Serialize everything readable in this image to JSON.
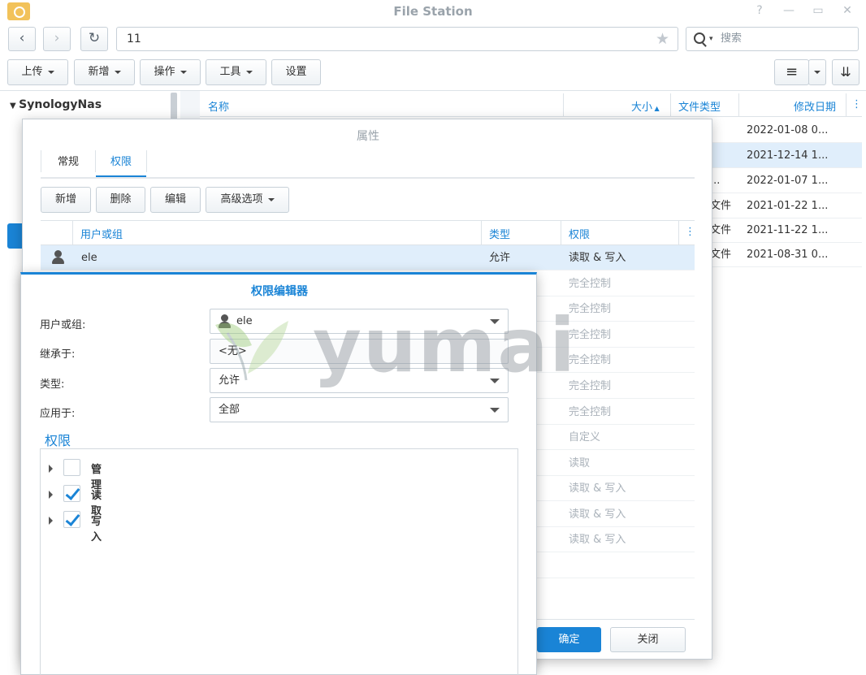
{
  "window": {
    "title": "File Station"
  },
  "nav": {
    "path": "11",
    "search_placeholder": "搜索"
  },
  "toolbar": {
    "upload": "上传",
    "new": "新增",
    "action": "操作",
    "tools": "工具",
    "settings": "设置"
  },
  "tree": {
    "root": "SynologyNas"
  },
  "file_list": {
    "columns": {
      "name": "名称",
      "size": "大小",
      "type": "文件类型",
      "modified": "修改日期"
    },
    "rows": [
      {
        "type": "",
        "modified": "2022-01-08 0..."
      },
      {
        "type": "",
        "modified": "2021-12-14 1...",
        "selected": true
      },
      {
        "type": "...",
        "modified": "2022-01-07 1..."
      },
      {
        "type": "文件",
        "modified": "2021-01-22 1..."
      },
      {
        "type": "文件",
        "modified": "2021-11-22 1..."
      },
      {
        "type": "文件",
        "modified": "2021-08-31 0..."
      }
    ]
  },
  "properties": {
    "title": "属性",
    "tabs": [
      "常规",
      "权限"
    ],
    "active_tab": "权限",
    "buttons": {
      "add": "新增",
      "delete": "删除",
      "edit": "编辑",
      "advanced": "高级选项"
    },
    "columns": {
      "user": "用户或组",
      "type": "类型",
      "perm": "权限"
    },
    "rows": [
      {
        "user": "ele",
        "type": "允许",
        "perm": "读取 & 写入",
        "selected": true
      },
      {
        "perm": "完全控制"
      },
      {
        "perm": "完全控制"
      },
      {
        "perm": "完全控制"
      },
      {
        "perm": "完全控制"
      },
      {
        "perm": "完全控制"
      },
      {
        "perm": "完全控制"
      },
      {
        "perm": "自定义"
      },
      {
        "perm": "读取"
      },
      {
        "perm": "读取 & 写入"
      },
      {
        "perm": "读取 & 写入"
      },
      {
        "perm": "读取 & 写入"
      }
    ],
    "ok": "确定",
    "close": "关闭"
  },
  "editor": {
    "title": "权限编辑器",
    "labels": {
      "user": "用户或组:",
      "inherit": "继承于:",
      "type": "类型:",
      "apply": "应用于:"
    },
    "values": {
      "user": "ele",
      "inherit": "<无>",
      "type": "允许",
      "apply": "全部"
    },
    "section": "权限",
    "perms": [
      {
        "label": "管理",
        "checked": false
      },
      {
        "label": "读取",
        "checked": true
      },
      {
        "label": "写入",
        "checked": true
      }
    ]
  },
  "watermark": {
    "text": "yumai"
  },
  "colors": {
    "accent": "#1a84d6",
    "selection": "#e0eefb",
    "border": "#c7d0d8"
  }
}
